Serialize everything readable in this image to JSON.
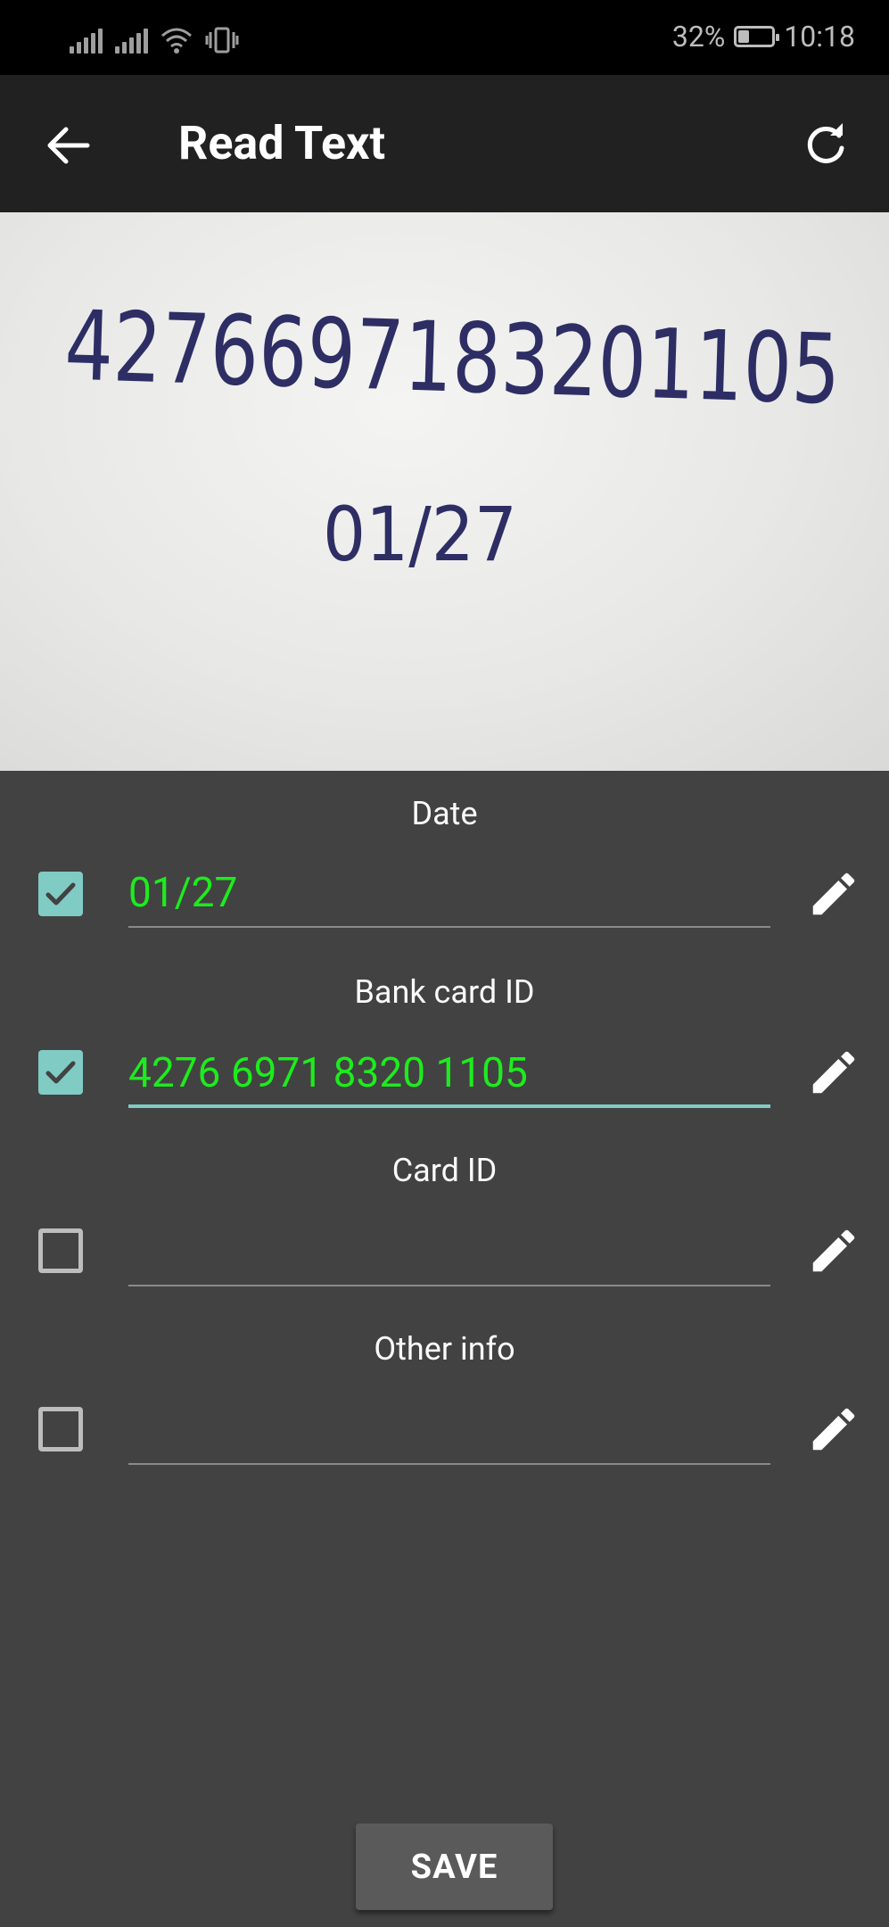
{
  "status_bar": {
    "battery": "32%",
    "battery_level": 0.32,
    "time": "10:18",
    "icons": [
      "signal-icon",
      "signal-icon",
      "wifi-icon",
      "vibrate-icon",
      "battery-icon"
    ]
  },
  "app_bar": {
    "title": "Read Text",
    "back_icon": "arrow-back-icon",
    "refresh_icon": "refresh-icon"
  },
  "photo": {
    "handwritten_number": "4276697183201105",
    "handwritten_date": "01/27"
  },
  "fields": [
    {
      "label": "Date",
      "value": "01/27",
      "checked": true,
      "focused": false
    },
    {
      "label": "Bank card ID",
      "value": "4276 6971 8320 1105",
      "checked": true,
      "focused": true
    },
    {
      "label": "Card ID",
      "value": "",
      "checked": false,
      "focused": false
    },
    {
      "label": "Other info",
      "value": "",
      "checked": false,
      "focused": false
    }
  ],
  "save_label": "SAVE",
  "colors": {
    "background": "#424242",
    "app_bar": "#212121",
    "accent": "#80cbc4",
    "value_text": "#1eeb1e",
    "ink": "#1e1e5a"
  }
}
